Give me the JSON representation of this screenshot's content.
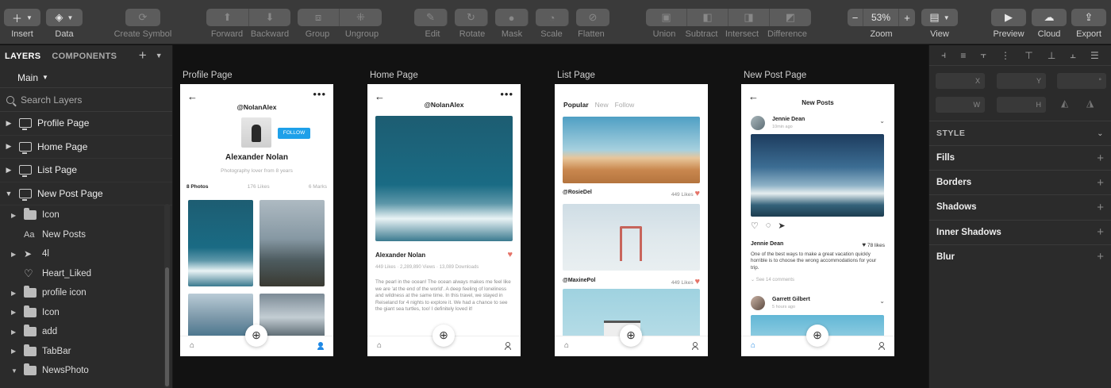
{
  "toolbar": {
    "insert": "Insert",
    "data": "Data",
    "create_symbol": "Create Symbol",
    "forward": "Forward",
    "backward": "Backward",
    "group": "Group",
    "ungroup": "Ungroup",
    "edit": "Edit",
    "rotate": "Rotate",
    "mask": "Mask",
    "scale": "Scale",
    "flatten": "Flatten",
    "union": "Union",
    "subtract": "Subtract",
    "intersect": "Intersect",
    "difference": "Difference",
    "zoom_label": "Zoom",
    "zoom_value": "53%",
    "zoom_minus": "−",
    "zoom_plus": "+",
    "view": "View",
    "preview": "Preview",
    "cloud": "Cloud",
    "export": "Export"
  },
  "left": {
    "tab_layers": "LAYERS",
    "tab_components": "COMPONENTS",
    "page_selector": "Main",
    "search_placeholder": "Search Layers",
    "pages": [
      "Profile Page",
      "Home Page",
      "List Page",
      "New Post Page"
    ],
    "layers": [
      {
        "label": "Icon",
        "type": "folder",
        "expandable": true
      },
      {
        "label": "New Posts",
        "type": "text",
        "expandable": false
      },
      {
        "label": "4l",
        "type": "plane",
        "expandable": true
      },
      {
        "label": "Heart_Liked",
        "type": "heart",
        "expandable": false
      },
      {
        "label": "profile icon",
        "type": "folder",
        "expandable": true
      },
      {
        "label": "Icon",
        "type": "folder",
        "expandable": true
      },
      {
        "label": "add",
        "type": "folder",
        "expandable": true
      },
      {
        "label": "TabBar",
        "type": "folder",
        "expandable": true
      },
      {
        "label": "NewsPhoto",
        "type": "folder",
        "expandable": true,
        "expanded": true
      }
    ],
    "text_icon_glyph": "Aa"
  },
  "right": {
    "fields": {
      "x": "X",
      "y": "Y",
      "rot": "°",
      "w": "W",
      "h": "H"
    },
    "style": "STYLE",
    "sections": [
      "Fills",
      "Borders",
      "Shadows",
      "Inner Shadows",
      "Blur"
    ]
  },
  "canvas": {
    "profile": {
      "label": "Profile Page",
      "handle": "@NolanAlex",
      "follow": "FOLLOW",
      "name": "Alexander Nolan",
      "bio": "Photography lover from 8 years",
      "stats": [
        "8 Photos",
        "176 Likes",
        "6 Marks"
      ]
    },
    "home": {
      "label": "Home Page",
      "handle": "@NolanAlex",
      "author": "Alexander Nolan",
      "meta": "449 Likes · 2,289,890 Views · 13,089 Downloads",
      "body": "The pearl in the ocean! The ocean always makes me feel like we are 'at the end of the world'. A deep feeling of loneliness and wildness at the same time. In this travel, we stayed in Reiseland for 4 nights to explore it. We had a chance to see the giant sea turtles, too! I definitely loved it!"
    },
    "list": {
      "label": "List Page",
      "tabs": [
        "Popular",
        "New",
        "Follow"
      ],
      "posts": [
        {
          "user": "@RosieDel",
          "likes": "449 Likes"
        },
        {
          "user": "@MaxinePol",
          "likes": "449 Likes"
        }
      ]
    },
    "newpost": {
      "label": "New Post Page",
      "title": "New Posts",
      "post1": {
        "user": "Jennie Dean",
        "time": "10min ago",
        "liker": "Jennie Dean",
        "likes": "78 likes",
        "caption": "One of the best ways to make a great vacation quickly horrible is to choose the wrong accommodations for your trip.",
        "comments": "See 14 comments"
      },
      "post2": {
        "user": "Garrett Gilbert",
        "time": "5 hours ago"
      }
    }
  }
}
